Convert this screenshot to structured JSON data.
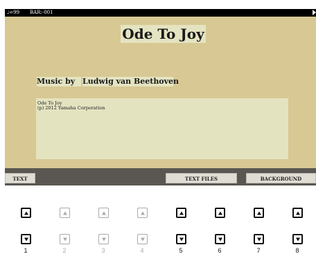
{
  "status_bar": {
    "tempo": "♩=99",
    "bar": "BAR:-001"
  },
  "song": {
    "title": "Ode To Joy",
    "composer_label": "Music by",
    "composer_name": "Ludwig van Beethoven",
    "memo_line1": "Ode To Joy",
    "memo_line2": "(p) 2012 Yamaha Corporation"
  },
  "softkeys": {
    "text": "TEXT",
    "text_files": "TEXT FILES",
    "background": "BACKGROUND"
  },
  "buttons": [
    {
      "number": "1",
      "active": true
    },
    {
      "number": "2",
      "active": false
    },
    {
      "number": "3",
      "active": false
    },
    {
      "number": "4",
      "active": false
    },
    {
      "number": "5",
      "active": true
    },
    {
      "number": "6",
      "active": true
    },
    {
      "number": "7",
      "active": true
    },
    {
      "number": "8",
      "active": true
    }
  ],
  "colors": {
    "panel_bg": "#d8c893",
    "text_highlight": "#e4e4c2",
    "softbar_bg": "#5a5752"
  }
}
